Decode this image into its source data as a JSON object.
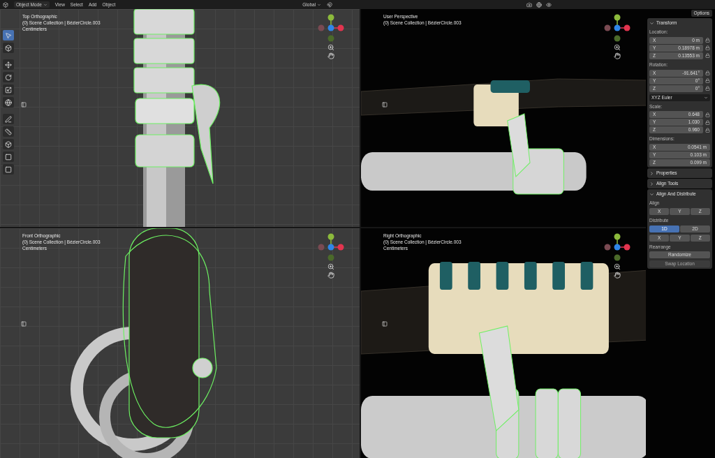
{
  "header": {
    "mode": "Object Mode",
    "menus": [
      "View",
      "Select",
      "Add",
      "Object"
    ],
    "orientation": "Global",
    "options": "Options"
  },
  "toolbar": {
    "tools": [
      {
        "selected": true
      },
      {
        "selected": false
      },
      {
        "selected": false
      },
      {
        "selected": false
      },
      {
        "selected": false
      },
      {
        "selected": false
      },
      {
        "selected": false
      },
      {
        "selected": false
      },
      {
        "selected": false
      },
      {
        "selected": false
      },
      {
        "selected": false
      }
    ]
  },
  "viewports": [
    {
      "kind": "top",
      "title": "Top Orthographic",
      "collection": "(0) Scene Collection | BézierCircle.003",
      "units": "Centimeters"
    },
    {
      "kind": "user",
      "title": "User Perspective",
      "collection": "(0) Scene Collection | BézierCircle.003"
    },
    {
      "kind": "front",
      "title": "Front Orthographic",
      "collection": "(0) Scene Collection | BézierCircle.003",
      "units": "Centimeters"
    },
    {
      "kind": "right",
      "title": "Right Orthographic",
      "collection": "(0) Scene Collection | BézierCircle.003",
      "units": "Centimeters"
    }
  ],
  "sidebar": {
    "panels": [
      {
        "title": "Transform",
        "expanded": true,
        "sections": [
          {
            "kind": "fields",
            "label": "Location:",
            "locks": true,
            "rows": [
              {
                "axis": "X",
                "value": "0 m"
              },
              {
                "axis": "Y",
                "value": "0.18978 m"
              },
              {
                "axis": "Z",
                "value": "0.13553 m"
              }
            ]
          },
          {
            "kind": "fields",
            "label": "Rotation:",
            "locks": true,
            "rows": [
              {
                "axis": "X",
                "value": "-91.641°"
              },
              {
                "axis": "Y",
                "value": "0°"
              },
              {
                "axis": "Z",
                "value": "0°"
              }
            ]
          },
          {
            "kind": "dropdown",
            "value": "XYZ Euler"
          },
          {
            "kind": "fields",
            "label": "Scale:",
            "locks": true,
            "rows": [
              {
                "axis": "X",
                "value": "0.648"
              },
              {
                "axis": "Y",
                "value": "1.030"
              },
              {
                "axis": "Z",
                "value": "0.960"
              }
            ]
          },
          {
            "kind": "fields",
            "label": "Dimensions:",
            "locks": false,
            "rows": [
              {
                "axis": "X",
                "value": "0.0541 m"
              },
              {
                "axis": "Y",
                "value": "0.103 m"
              },
              {
                "axis": "Z",
                "value": "0.099 m"
              }
            ]
          }
        ]
      },
      {
        "title": "Properties",
        "expanded": false
      },
      {
        "title": "Align Tools",
        "expanded": false
      },
      {
        "title": "Align And Distribute",
        "expanded": true,
        "sections": [
          {
            "kind": "buttons",
            "label": "Align",
            "buttons": [
              {
                "label": "X"
              },
              {
                "label": "Y"
              },
              {
                "label": "Z"
              }
            ]
          },
          {
            "kind": "buttons",
            "label": "Distribute",
            "buttons": [
              {
                "label": "1D",
                "selected": true
              },
              {
                "label": "2D",
                "selected": false
              }
            ]
          },
          {
            "kind": "buttons",
            "buttons": [
              {
                "label": "X"
              },
              {
                "label": "Y"
              },
              {
                "label": "Z"
              }
            ]
          },
          {
            "kind": "buttons",
            "label": "Rearrange",
            "buttons": [
              {
                "label": "Randomize",
                "disabled": false
              }
            ]
          },
          {
            "kind": "buttons",
            "buttons": [
              {
                "label": "Swap Location",
                "disabled": true
              }
            ]
          }
        ]
      }
    ]
  }
}
